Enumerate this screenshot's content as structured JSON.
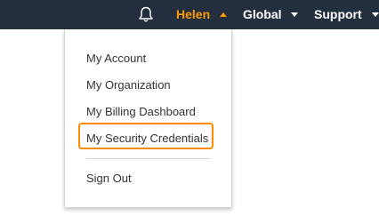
{
  "topbar": {
    "user_label": "Helen",
    "region_label": "Global",
    "support_label": "Support"
  },
  "icons": {
    "notifications": "bell-icon",
    "user_caret": "caret-up-icon",
    "region_caret": "caret-down-icon",
    "support_caret": "caret-down-icon"
  },
  "colors": {
    "topbar_bg": "#232f3e",
    "active_accent": "#ff9900",
    "highlight_border": "#ff8c00",
    "nav_text": "#ffffff",
    "menu_text": "#333333"
  },
  "user_menu": {
    "items": [
      {
        "label": "My Account"
      },
      {
        "label": "My Organization"
      },
      {
        "label": "My Billing Dashboard"
      },
      {
        "label": "My Security Credentials",
        "highlighted": true
      }
    ],
    "sign_out_label": "Sign Out"
  }
}
